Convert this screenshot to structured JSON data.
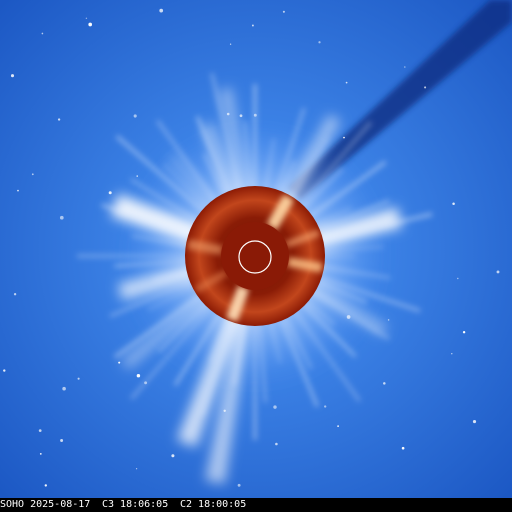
{
  "caption": {
    "mission_date": "SOHO 2025-08-17",
    "c3_time": "C3 18:06:05",
    "c2_time": "C2 18:00:05"
  },
  "colors": {
    "sky": "#2e74dd",
    "sky_deep": "#1c56c2",
    "streamer": "#ffffff",
    "occulter": "#8c1b05",
    "occulter_glow": "#d9642a",
    "sun_outline": "#ffffff"
  }
}
